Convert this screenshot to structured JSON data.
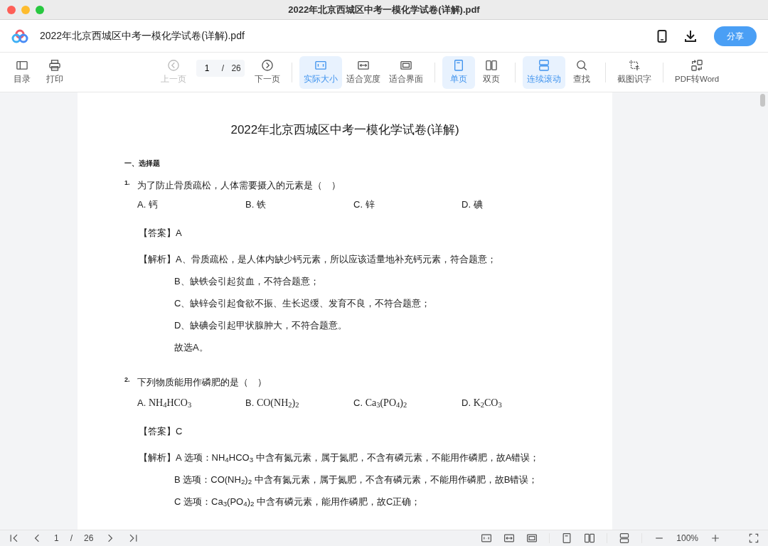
{
  "window": {
    "title": "2022年北京西城区中考一模化学试卷(详解).pdf"
  },
  "header": {
    "file_name": "2022年北京西城区中考一模化学试卷(详解).pdf",
    "share_button": "分享"
  },
  "toolbar_groups": [
    {
      "items": [
        {
          "label": "目录",
          "disabled": false,
          "selected": false
        },
        {
          "label": "打印",
          "disabled": false,
          "selected": false
        }
      ]
    },
    {
      "items": [
        {
          "label": "上一页",
          "disabled": true,
          "selected": false
        },
        {
          "label": "下一页",
          "disabled": false,
          "selected": false
        }
      ],
      "page_field": {
        "value": "1",
        "separator": "/",
        "total": "26"
      }
    },
    {
      "items": [
        {
          "label": "实际大小",
          "disabled": false,
          "selected": true
        },
        {
          "label": "适合宽度",
          "disabled": false,
          "selected": false
        },
        {
          "label": "适合界面",
          "disabled": false,
          "selected": false
        }
      ]
    },
    {
      "items": [
        {
          "label": "单页",
          "disabled": false,
          "selected": true
        },
        {
          "label": "双页",
          "disabled": false,
          "selected": false
        }
      ]
    },
    {
      "items": [
        {
          "label": "连续滚动",
          "disabled": false,
          "selected": true
        },
        {
          "label": "查找",
          "disabled": false,
          "selected": false
        }
      ]
    },
    {
      "items": [
        {
          "label": "截图识字",
          "disabled": false,
          "selected": false
        }
      ]
    },
    {
      "items": [
        {
          "label": "PDF转Word",
          "disabled": false,
          "selected": false
        }
      ]
    }
  ],
  "document": {
    "title": "2022年北京西城区中考一模化学试卷(详解)",
    "section": "一、选择题",
    "questions": [
      {
        "number": "1.",
        "text": "为了防止骨质疏松，人体需要摄入的元素是（　）",
        "options": [
          {
            "letter": "A.",
            "text": "钙"
          },
          {
            "letter": "B.",
            "text": "铁"
          },
          {
            "letter": "C.",
            "text": "锌"
          },
          {
            "letter": "D.",
            "text": "碘"
          }
        ],
        "answer_label": "【答案】",
        "answer": "A",
        "analysis_label": "【解析】",
        "analysis": [
          "A、骨质疏松，是人体内缺少钙元素，所以应该适量地补充钙元素，符合题意；",
          "B、缺铁会引起贫血，不符合题意；",
          "C、缺锌会引起食欲不振、生长迟缓、发育不良，不符合题意；",
          "D、缺碘会引起甲状腺肿大，不符合题意。",
          "故选A。"
        ]
      },
      {
        "number": "2.",
        "text": "下列物质能用作磷肥的是（　）",
        "options": [
          {
            "letter": "A.",
            "text": "NH$_{4}$HCO$_{3}$"
          },
          {
            "letter": "B.",
            "text": "CO(NH$_{2}$)$_{2}$"
          },
          {
            "letter": "C.",
            "text": "Ca$_{3}$(PO$_{4}$)$_{2}$"
          },
          {
            "letter": "D.",
            "text": "K$_{2}$CO$_{3}$"
          }
        ],
        "answer_label": "【答案】",
        "answer": "C",
        "analysis_label": "【解析】",
        "analysis": [
          "A 选项：NH$_{4}$HCO$_{3}$ 中含有氮元素，属于氮肥，不含有磷元素，不能用作磷肥，故A错误；",
          "B 选项：CO(NH$_{2}$)$_{2}$ 中含有氮元素，属于氮肥，不含有磷元素，不能用作磷肥，故B错误；",
          "C 选项：Ca$_{3}$(PO$_{4}$)$_{2}$ 中含有磷元素，能用作磷肥，故C正确；"
        ]
      }
    ]
  },
  "status_bar": {
    "page": "1",
    "separator": "/",
    "total": "26",
    "zoom": "100%"
  }
}
